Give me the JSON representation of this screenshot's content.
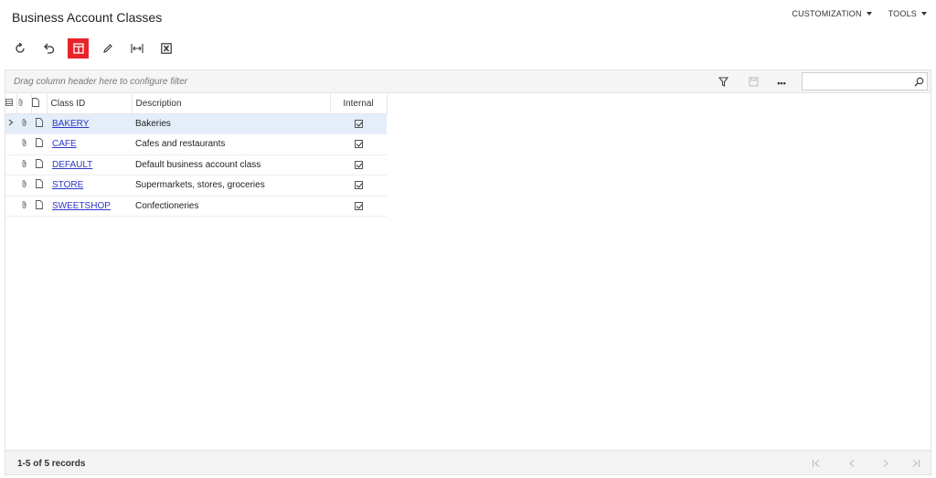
{
  "page": {
    "title": "Business Account Classes"
  },
  "topmenu": {
    "customization": "CUSTOMIZATION",
    "tools": "TOOLS"
  },
  "toolbar": {
    "buttons": [
      {
        "icon": "refresh-icon"
      },
      {
        "icon": "undo-icon"
      },
      {
        "icon": "add-row-icon",
        "active": true
      },
      {
        "icon": "edit-pencil-icon"
      },
      {
        "icon": "fit-columns-icon"
      },
      {
        "icon": "excel-export-icon"
      }
    ],
    "accent": "#e8242b"
  },
  "filterbar": {
    "hint": "Drag column header here to configure filter",
    "search": {
      "value": "",
      "placeholder": ""
    },
    "more": "•••"
  },
  "grid": {
    "columns": {
      "class_id": "Class ID",
      "description": "Description",
      "internal": "Internal"
    },
    "rows": [
      {
        "class_id": "BAKERY",
        "description": "Bakeries",
        "internal": true,
        "selected": true
      },
      {
        "class_id": "CAFE",
        "description": "Cafes and restaurants",
        "internal": true
      },
      {
        "class_id": "DEFAULT",
        "description": "Default business account class",
        "internal": true
      },
      {
        "class_id": "STORE",
        "description": "Supermarkets, stores, groceries",
        "internal": true
      },
      {
        "class_id": "SWEETSHOP",
        "description": "Confectioneries",
        "internal": true
      }
    ],
    "link_color": "#2d37c8",
    "selected_color": "#e4eef9"
  },
  "footer": {
    "records": "1-5 of 5 records"
  }
}
